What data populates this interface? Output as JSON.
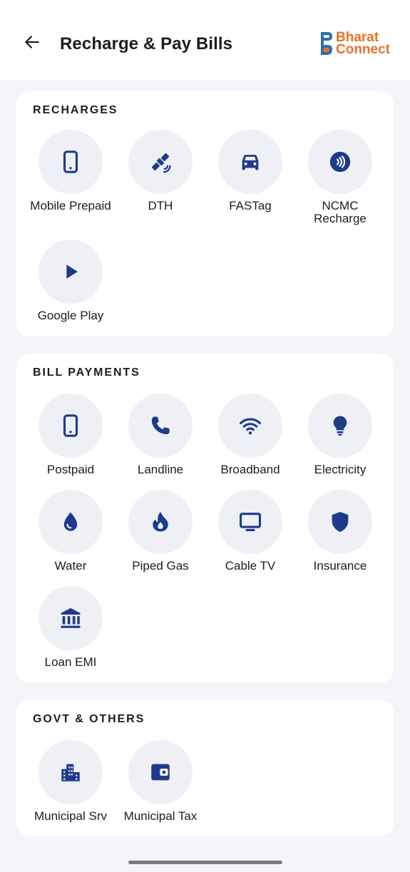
{
  "header": {
    "title": "Recharge & Pay Bills",
    "back_icon": "arrow-left-icon",
    "brand": {
      "line1": "Bharat",
      "line2": "Connect",
      "color": "#e8732b",
      "mark_color": "#2a6fb3"
    }
  },
  "accent_color": "#1e3a8a",
  "sections": {
    "recharges": {
      "title": "RECHARGES",
      "items": [
        {
          "label": "Mobile Prepaid",
          "icon": "mobile-icon"
        },
        {
          "label": "DTH",
          "icon": "satellite-icon"
        },
        {
          "label": "FASTag",
          "icon": "car-icon"
        },
        {
          "label": "NCMC\nRecharge",
          "icon": "contactless-icon"
        },
        {
          "label": "Google Play",
          "icon": "play-icon"
        }
      ]
    },
    "bills": {
      "title": "BILL PAYMENTS",
      "items": [
        {
          "label": "Postpaid",
          "icon": "mobile-icon"
        },
        {
          "label": "Landline",
          "icon": "phone-icon"
        },
        {
          "label": "Broadband",
          "icon": "wifi-icon"
        },
        {
          "label": "Electricity",
          "icon": "bulb-icon"
        },
        {
          "label": "Water",
          "icon": "water-drop-icon"
        },
        {
          "label": "Piped Gas",
          "icon": "flame-icon"
        },
        {
          "label": "Cable TV",
          "icon": "tv-icon"
        },
        {
          "label": "Insurance",
          "icon": "shield-icon"
        },
        {
          "label": "Loan EMI",
          "icon": "bank-icon"
        }
      ]
    },
    "govt": {
      "title": "GOVT & OTHERS",
      "items": [
        {
          "label": "Municipal Srv",
          "icon": "building-icon"
        },
        {
          "label": "Municipal Tax",
          "icon": "wallet-icon"
        }
      ]
    }
  }
}
